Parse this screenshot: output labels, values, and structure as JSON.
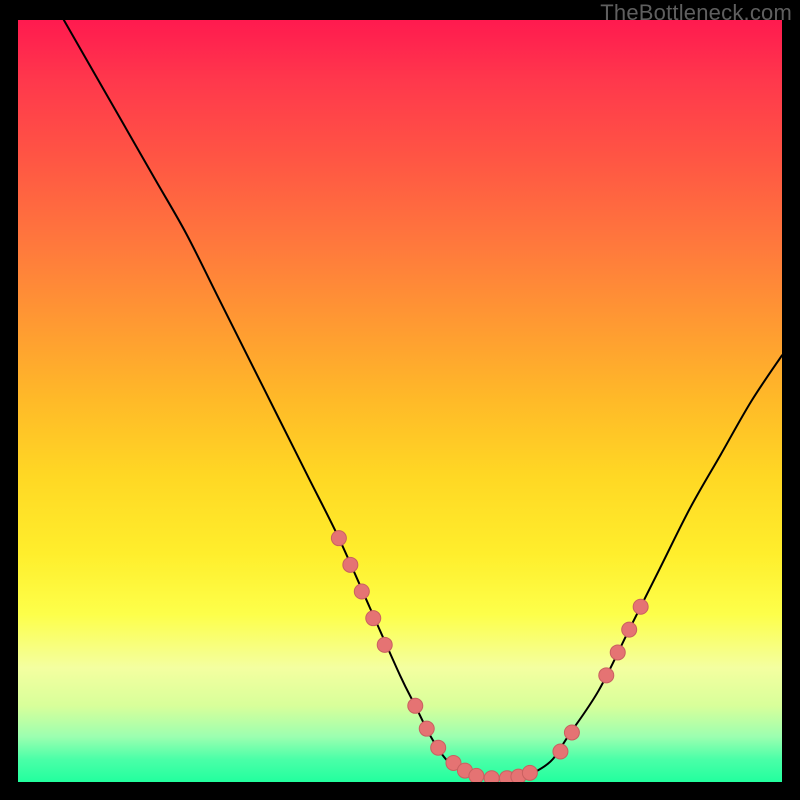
{
  "watermark": "TheBottleneck.com",
  "colors": {
    "curve": "#000000",
    "marker_fill": "#e57373",
    "marker_stroke": "#c96060"
  },
  "chart_data": {
    "type": "line",
    "title": "",
    "xlabel": "",
    "ylabel": "",
    "xlim": [
      0,
      100
    ],
    "ylim": [
      0,
      100
    ],
    "grid": false,
    "series": [
      {
        "name": "bottleneck-curve",
        "x": [
          6,
          10,
          14,
          18,
          22,
          26,
          30,
          34,
          38,
          42,
          46,
          50,
          52,
          54,
          56,
          58,
          60,
          62,
          64,
          66,
          68,
          70,
          72,
          76,
          80,
          84,
          88,
          92,
          96,
          100
        ],
        "y": [
          100,
          93,
          86,
          79,
          72,
          64,
          56,
          48,
          40,
          32,
          23,
          14,
          10,
          6,
          3,
          1.5,
          0.8,
          0.5,
          0.5,
          0.8,
          1.5,
          3,
          6,
          12,
          20,
          28,
          36,
          43,
          50,
          56
        ]
      }
    ],
    "markers": {
      "name": "highlighted-points",
      "points": [
        {
          "x": 42,
          "y": 32
        },
        {
          "x": 43.5,
          "y": 28.5
        },
        {
          "x": 45,
          "y": 25
        },
        {
          "x": 46.5,
          "y": 21.5
        },
        {
          "x": 48,
          "y": 18
        },
        {
          "x": 52,
          "y": 10
        },
        {
          "x": 53.5,
          "y": 7
        },
        {
          "x": 55,
          "y": 4.5
        },
        {
          "x": 57,
          "y": 2.5
        },
        {
          "x": 58.5,
          "y": 1.5
        },
        {
          "x": 60,
          "y": 0.8
        },
        {
          "x": 62,
          "y": 0.5
        },
        {
          "x": 64,
          "y": 0.5
        },
        {
          "x": 65.5,
          "y": 0.7
        },
        {
          "x": 67,
          "y": 1.2
        },
        {
          "x": 71,
          "y": 4
        },
        {
          "x": 72.5,
          "y": 6.5
        },
        {
          "x": 77,
          "y": 14
        },
        {
          "x": 78.5,
          "y": 17
        },
        {
          "x": 80,
          "y": 20
        },
        {
          "x": 81.5,
          "y": 23
        }
      ]
    }
  }
}
